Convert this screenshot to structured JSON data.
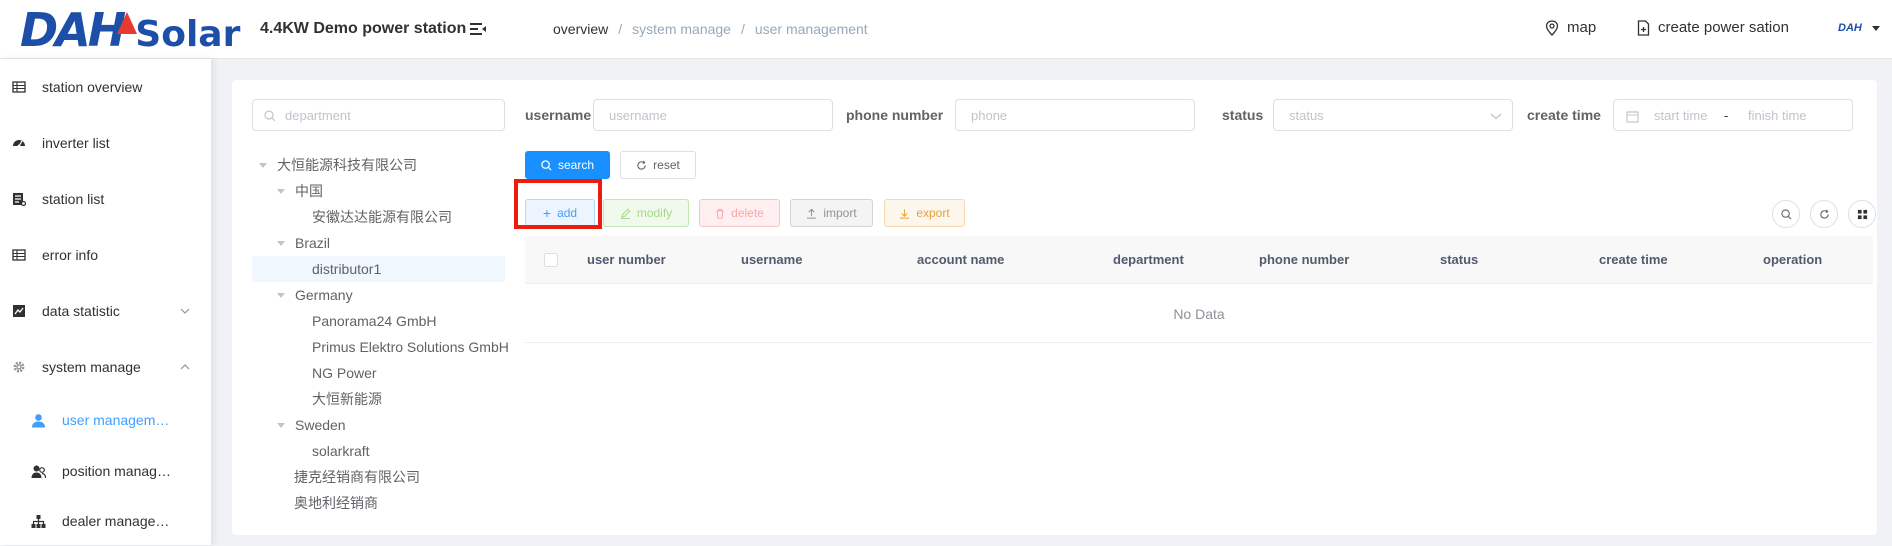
{
  "header": {
    "logo_text_left": "DAH",
    "logo_text_right": "Solar",
    "station_title": "4.4KW Demo power station",
    "breadcrumb": [
      "overview",
      "system manage",
      "user management"
    ],
    "breadcrumb_sep": "/",
    "map_label": "map",
    "create_label": "create power sation",
    "avatar_text": "DAH"
  },
  "sidebar": {
    "items": [
      {
        "label": "station overview",
        "icon": "table-icon"
      },
      {
        "label": "inverter list",
        "icon": "dashboard-icon"
      },
      {
        "label": "station list",
        "icon": "list-icon"
      },
      {
        "label": "error info",
        "icon": "table-icon"
      },
      {
        "label": "data statistic",
        "icon": "chart-icon"
      },
      {
        "label": "system manage",
        "icon": "gear-icon"
      }
    ],
    "sub_items": [
      {
        "label": "user management",
        "icon": "user-icon"
      },
      {
        "label": "position management",
        "icon": "users-icon"
      },
      {
        "label": "dealer management",
        "icon": "tree-icon"
      }
    ]
  },
  "filters": {
    "department_placeholder": "department",
    "username_label": "username",
    "username_placeholder": "username",
    "phone_label": "phone number",
    "phone_placeholder": "phone",
    "status_label": "status",
    "status_placeholder": "status",
    "create_time_label": "create time",
    "start_placeholder": "start time",
    "range_sep": "-",
    "finish_placeholder": "finish time"
  },
  "tree": [
    {
      "label": "大恒能源科技有限公司",
      "level": 0,
      "expanded": true
    },
    {
      "label": "中国",
      "level": 1,
      "expanded": true
    },
    {
      "label": "安徽达达能源有限公司",
      "level": 2
    },
    {
      "label": "Brazil",
      "level": 1,
      "expanded": true
    },
    {
      "label": "distributor1",
      "level": 2,
      "selected": true
    },
    {
      "label": "Germany",
      "level": 1,
      "expanded": true
    },
    {
      "label": "Panorama24 GmbH",
      "level": 2
    },
    {
      "label": "Primus Elektro Solutions GmbH",
      "level": 2
    },
    {
      "label": "NG Power",
      "level": 2
    },
    {
      "label": "大恒新能源",
      "level": 2
    },
    {
      "label": "Sweden",
      "level": 1,
      "expanded": true
    },
    {
      "label": "solarkraft",
      "level": 2
    },
    {
      "label": "捷克经销商有限公司",
      "level": 1
    },
    {
      "label": "奥地利经销商",
      "level": 1
    }
  ],
  "buttons": {
    "search": "search",
    "reset": "reset",
    "add": "add",
    "modify": "modify",
    "delete": "delete",
    "import": "import",
    "export": "export"
  },
  "table": {
    "columns": [
      "user number",
      "username",
      "account name",
      "department",
      "phone number",
      "status",
      "create time",
      "operation"
    ],
    "empty_text": "No Data"
  },
  "colors": {
    "primary": "#1890ff",
    "highlight": "#ee1c0c",
    "brand": "#1d4fa8"
  }
}
